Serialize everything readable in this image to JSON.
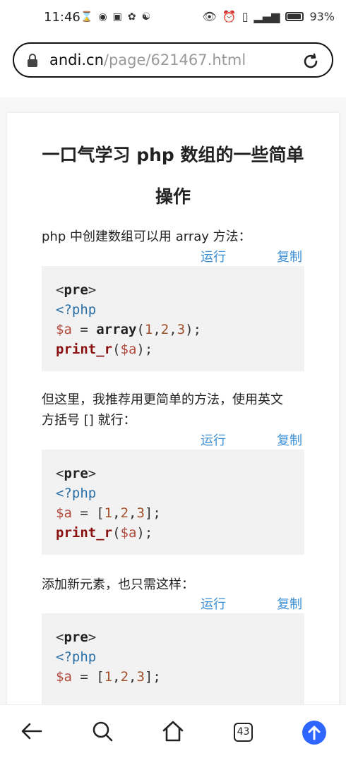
{
  "status_bar": {
    "time": "11:46",
    "battery_percent": "93%",
    "battery_level": 0.93
  },
  "browser": {
    "url_host": "andi.cn",
    "url_path": "/page/621467.html",
    "tab_count": "43"
  },
  "article": {
    "title_line1": "一口气学习 php 数组的一些简单",
    "title_line2": "操作",
    "sections": [
      {
        "text": "php 中创建数组可以用 array 方法：",
        "run_label": "运行",
        "copy_label": "复制",
        "code": {
          "l1_open": "<",
          "l1_tag": "pre",
          "l1_close": ">",
          "l2": "<?php",
          "l3_var": "$a",
          "l3_eq": " = ",
          "l3_fn": "array",
          "l3_rest_open": "(",
          "l3_n1": "1",
          "l3_c1": ",",
          "l3_n2": "2",
          "l3_c2": ",",
          "l3_n3": "3",
          "l3_rest_close": ");",
          "l4_fn": "print_r",
          "l4_open": "(",
          "l4_var": "$a",
          "l4_close": ");"
        }
      },
      {
        "text_line1": "但这里，我推荐用更简单的方法，使用英文",
        "text_line2": "方括号 [] 就行：",
        "run_label": "运行",
        "copy_label": "复制",
        "code": {
          "l1_open": "<",
          "l1_tag": "pre",
          "l1_close": ">",
          "l2": "<?php",
          "l3_var": "$a",
          "l3_eq": " = [",
          "l3_n1": "1",
          "l3_c1": ",",
          "l3_n2": "2",
          "l3_c2": ",",
          "l3_n3": "3",
          "l3_close": "];",
          "l4_fn": "print_r",
          "l4_open": "(",
          "l4_var": "$a",
          "l4_close": ");"
        }
      },
      {
        "text": "添加新元素，也只需这样：",
        "run_label": "运行",
        "copy_label": "复制",
        "code": {
          "l1_open": "<",
          "l1_tag": "pre",
          "l1_close": ">",
          "l2": "<?php",
          "l3_var": "$a",
          "l3_eq": " = [",
          "l3_n1": "1",
          "l3_c1": ",",
          "l3_n2": "2",
          "l3_c2": ",",
          "l3_n3": "3",
          "l3_close": "];"
        }
      }
    ]
  },
  "icons": {
    "back": "back-arrow-icon",
    "search": "search-icon",
    "home": "home-icon",
    "tabs": "tabs-icon",
    "scroll_top": "arrow-up-icon"
  },
  "colors": {
    "link": "#3b8fd6",
    "scroll_top_button": "#2f66ff"
  }
}
